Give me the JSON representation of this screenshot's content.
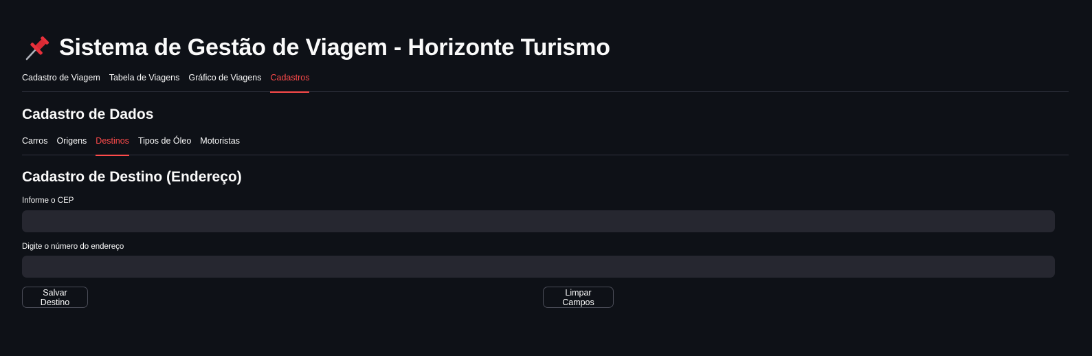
{
  "header": {
    "icon": "pushpin-icon",
    "title": "Sistema de Gestão de Viagem - Horizonte Turismo"
  },
  "main_tabs": [
    {
      "label": "Cadastro de Viagem",
      "active": false
    },
    {
      "label": "Tabela de Viagens",
      "active": false
    },
    {
      "label": "Gráfico de Viagens",
      "active": false
    },
    {
      "label": "Cadastros",
      "active": true
    }
  ],
  "section": {
    "title": "Cadastro de Dados"
  },
  "sub_tabs": [
    {
      "label": "Carros",
      "active": false
    },
    {
      "label": "Origens",
      "active": false
    },
    {
      "label": "Destinos",
      "active": true
    },
    {
      "label": "Tipos de Óleo",
      "active": false
    },
    {
      "label": "Motoristas",
      "active": false
    }
  ],
  "form": {
    "title": "Cadastro de Destino (Endereço)",
    "cep_label": "Informe o CEP",
    "cep_value": "",
    "number_label": "Digite o número do endereço",
    "number_value": "",
    "save_label": "Salvar Destino",
    "clear_label": "Limpar Campos"
  },
  "colors": {
    "background": "#0e1117",
    "accent": "#ff4b4b",
    "input_bg": "#262730"
  }
}
